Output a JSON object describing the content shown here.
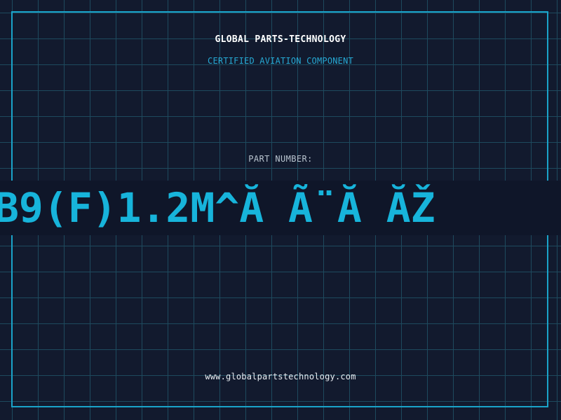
{
  "header": {
    "company": "GLOBAL PARTS-TECHNOLOGY",
    "tagline": "CERTIFIED AVIATION COMPONENT"
  },
  "part": {
    "label": "PART NUMBER:",
    "value": "B9(F)1.2M^Ă Ã¨Ă ĂŽ"
  },
  "footer": {
    "website": "www.globalpartstechnology.com"
  },
  "colors": {
    "background": "#121a2e",
    "grid": "#1e4a5e",
    "accent": "#1aa3c9",
    "text": "#ffffff"
  }
}
